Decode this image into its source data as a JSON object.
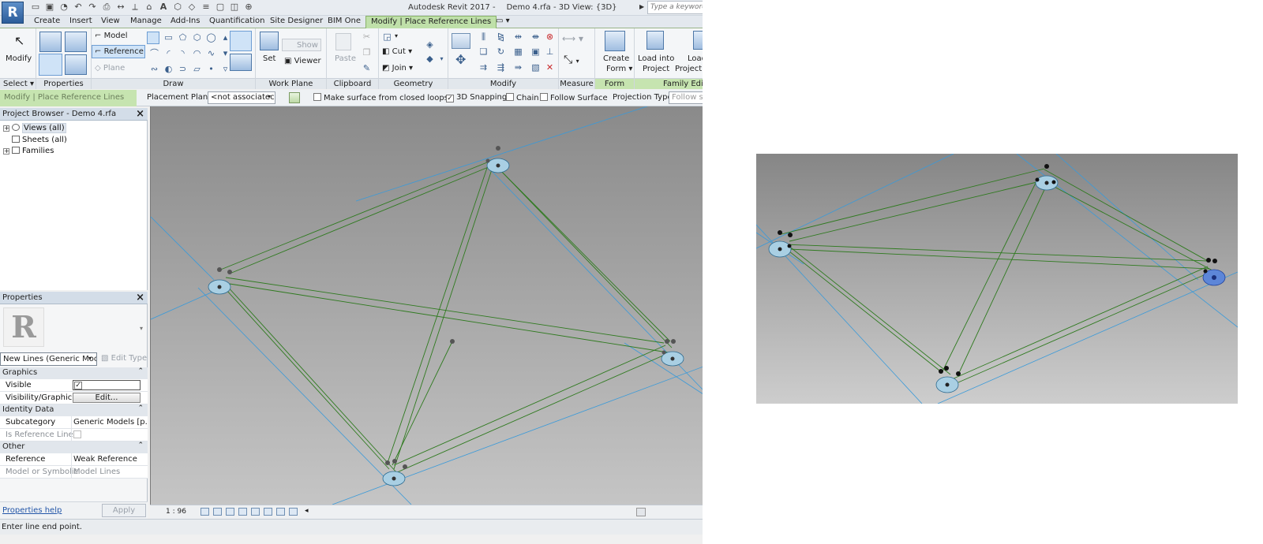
{
  "app": {
    "logo": "R",
    "title": "Autodesk Revit 2017 -",
    "document": "Demo 4.rfa - 3D View: {3D}",
    "search_placeholder": "Type a keyword or",
    "status": "Enter line end point."
  },
  "tabs": [
    {
      "label": "Create"
    },
    {
      "label": "Insert"
    },
    {
      "label": "View"
    },
    {
      "label": "Manage"
    },
    {
      "label": "Add-Ins"
    },
    {
      "label": "Quantification"
    },
    {
      "label": "Site Designer"
    },
    {
      "label": "BIM One"
    },
    {
      "label": "Modify | Place Reference Lines",
      "active": true
    }
  ],
  "ribbon": {
    "panels": {
      "select": "Select",
      "properties": "Properties",
      "draw": "Draw",
      "work_plane": "Work Plane",
      "clipboard": "Clipboard",
      "geometry": "Geometry",
      "modify": "Modify",
      "measure": "Measure",
      "form": "Form",
      "family_editor": "Family Edit"
    },
    "modify_label": "Modify",
    "model_label": "Model",
    "reference_label": "Reference",
    "plane_label": "Plane",
    "set_label": "Set",
    "show_label": "Show",
    "viewer_label": "Viewer",
    "paste_label": "Paste",
    "cut_label": "Cut",
    "join_label": "Join",
    "create_form_1": "Create",
    "create_form_2": "Form",
    "load_into_project_1": "Load into",
    "load_into_project_2": "Project",
    "load_into_project_close_1": "Load",
    "load_into_project_close_2": "Project a"
  },
  "options_bar": {
    "context": "Modify | Place Reference Lines",
    "placement_plane_label": "Placement Plane:",
    "placement_plane_value": "<not associatec",
    "make_surface": "Make surface from closed loops",
    "snapping_3d": "3D Snapping",
    "chain": "Chain",
    "follow_surface": "Follow Surface",
    "projection_type_label": "Projection Type:",
    "projection_type_value": "Follow surfa"
  },
  "project_browser": {
    "title": "Project Browser - Demo 4.rfa",
    "items": [
      {
        "label": "Views (all)"
      },
      {
        "label": "Sheets (all)"
      },
      {
        "label": "Families"
      }
    ]
  },
  "properties": {
    "title": "Properties",
    "type_selector": "New Lines (Generic Moc",
    "edit_type": "Edit Type",
    "groups": {
      "graphics": "Graphics",
      "identity": "Identity Data",
      "other": "Other"
    },
    "rows": {
      "visible": "Visible",
      "visibility": "Visibility/Graphic...",
      "visibility_btn": "Edit...",
      "subcategory": "Subcategory",
      "subcategory_val": "Generic Models [p...",
      "is_reference": "Is Reference Line",
      "reference": "Reference",
      "reference_val": "Weak Reference",
      "model_symbolic": "Model or Symbolic",
      "model_symbolic_val": "Model Lines"
    },
    "help": "Properties help",
    "apply": "Apply"
  },
  "view_control": {
    "scale": "1 : 96"
  },
  "colors": {
    "reference_line": "#2f7a1f",
    "work_plane_line": "#3a9ad9",
    "active_tab": "#bfe0a9"
  }
}
